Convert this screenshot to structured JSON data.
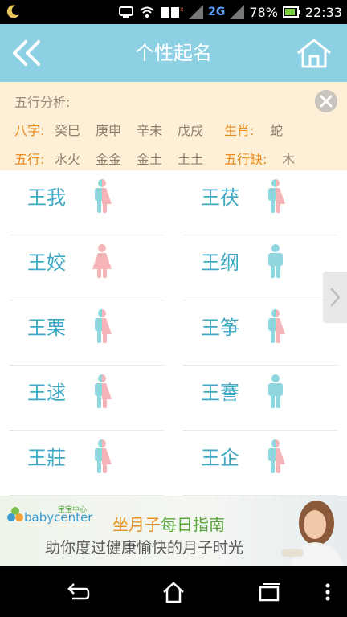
{
  "status_bar": {
    "battery_percent": "78%",
    "time": "22:33",
    "network": "2G",
    "icons": [
      "moon-icon",
      "usb-icon",
      "wifi-icon",
      "sim-icon",
      "signal-icon",
      "battery-icon"
    ]
  },
  "header": {
    "title": "个性起名",
    "back_icon": "double-chevron-left-icon",
    "home_icon": "home-icon"
  },
  "analysis": {
    "heading": "五行分析:",
    "bazi_label": "八字:",
    "bazi": [
      "癸巳",
      "庚申",
      "辛未",
      "戊戌"
    ],
    "zodiac_label": "生肖:",
    "zodiac": "蛇",
    "wuxing_label": "五行:",
    "wuxing": [
      "水火",
      "金金",
      "金土",
      "土土"
    ],
    "missing_label": "五行缺:",
    "missing": "木"
  },
  "names": [
    {
      "name": "王我",
      "gender": "unisex"
    },
    {
      "name": "王茯",
      "gender": "unisex"
    },
    {
      "name": "王姣",
      "gender": "female"
    },
    {
      "name": "王纲",
      "gender": "male"
    },
    {
      "name": "王栗",
      "gender": "unisex"
    },
    {
      "name": "王筝",
      "gender": "unisex"
    },
    {
      "name": "王逑",
      "gender": "unisex"
    },
    {
      "name": "王謇",
      "gender": "male"
    },
    {
      "name": "王莊",
      "gender": "unisex"
    },
    {
      "name": "王企",
      "gender": "unisex"
    }
  ],
  "banner": {
    "brand_cn": "宝宝中心",
    "brand_en": "babycenter",
    "line1_a": "坐月子",
    "line1_b": "每日指南",
    "line2": "助你度过健康愉快的月子时光"
  },
  "colors": {
    "header": "#8dd0e4",
    "name_text": "#3ea8c4",
    "male": "#8fd6df",
    "female": "#f5b4b8",
    "label_orange": "#e88a1d"
  }
}
